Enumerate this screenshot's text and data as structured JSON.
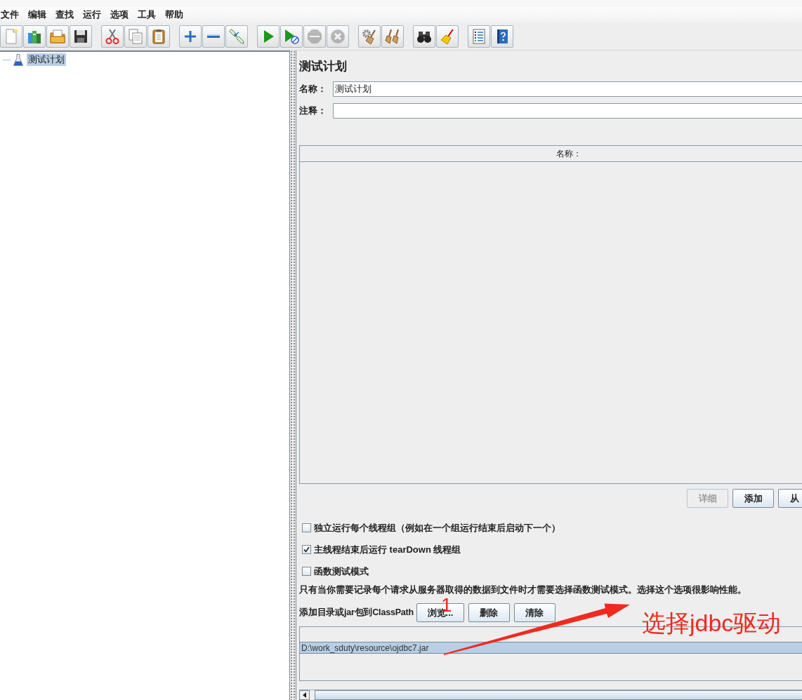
{
  "menu": [
    "文件",
    "编辑",
    "查找",
    "运行",
    "选项",
    "工具",
    "帮助"
  ],
  "toolbar": [
    {
      "buttons": [
        {
          "kind": "new",
          "disabled": false
        },
        {
          "kind": "templates",
          "disabled": false
        },
        {
          "kind": "open",
          "disabled": false
        },
        {
          "kind": "save",
          "disabled": false
        }
      ]
    },
    {
      "buttons": [
        {
          "kind": "cut",
          "disabled": false
        },
        {
          "kind": "copy",
          "disabled": false
        },
        {
          "kind": "paste",
          "disabled": false
        }
      ]
    },
    {
      "buttons": [
        {
          "kind": "expand",
          "disabled": false
        },
        {
          "kind": "collapse",
          "disabled": false
        },
        {
          "kind": "toggle",
          "disabled": false
        }
      ]
    },
    {
      "buttons": [
        {
          "kind": "start",
          "disabled": false
        },
        {
          "kind": "start_no_pauses",
          "disabled": false
        },
        {
          "kind": "stop",
          "disabled": true
        },
        {
          "kind": "shutdown",
          "disabled": true
        }
      ]
    },
    {
      "buttons": [
        {
          "kind": "clear",
          "disabled": false
        },
        {
          "kind": "clear_all",
          "disabled": false
        }
      ]
    },
    {
      "buttons": [
        {
          "kind": "search",
          "disabled": false
        },
        {
          "kind": "reset_search",
          "disabled": false
        }
      ]
    },
    {
      "buttons": [
        {
          "kind": "function_helper",
          "disabled": false
        },
        {
          "kind": "help",
          "disabled": false
        }
      ]
    }
  ],
  "tree": {
    "items": [
      {
        "label": "测试计划",
        "selected": true
      }
    ]
  },
  "panel": {
    "title": "测试计划",
    "fields": [
      {
        "label": "名称：",
        "value": "测试计划"
      },
      {
        "label": "注释："
      }
    ]
  },
  "variables_table": {
    "columns": [
      "名称："
    ]
  },
  "table_buttons": [
    {
      "label": "详细",
      "disabled": true
    },
    {
      "label": "添加",
      "disabled": false
    },
    {
      "label": "从",
      "disabled": false
    }
  ],
  "options": [
    {
      "label": "独立运行每个线程组（例如在一个组运行结束后启动下一个）",
      "checked": false
    },
    {
      "label": "主线程结束后运行 tearDown 线程组",
      "checked": true
    },
    {
      "label": "函数测试模式",
      "checked": false
    }
  ],
  "note": "只有当你需要记录每个请求从服务器取得的数据到文件时才需要选择函数测试模式。选择这个选项很影响性能。",
  "classpath": {
    "label": "添加目录或jar包到ClassPath",
    "buttons": [
      "浏览...",
      "删除",
      "清除"
    ],
    "entries": [
      {
        "path": "D:\\work_sduty\\resource\\ojdbc7.jar",
        "selected": true
      }
    ]
  },
  "annotation": {
    "step": "1",
    "callout": "选择jdbc驱动"
  }
}
